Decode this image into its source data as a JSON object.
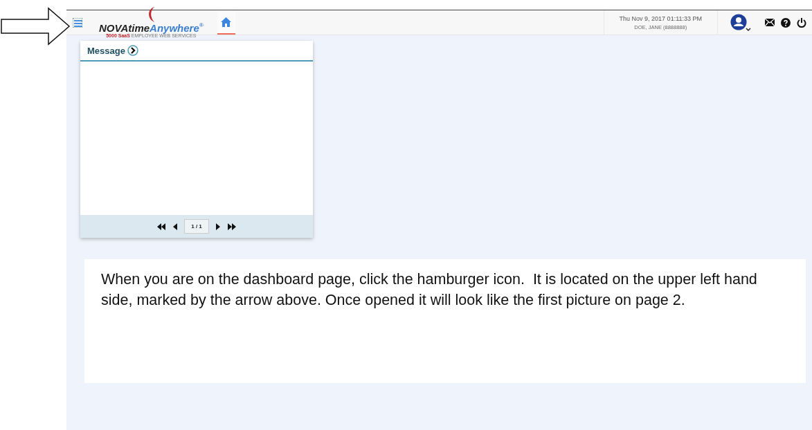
{
  "header": {
    "logo": {
      "brand_dark": "NOVAtime",
      "brand_light": "Anywhere",
      "mark": "®",
      "sub_red": "5000 SaaS",
      "sub_grey": "EMPLOYEE WEB SERVICES"
    },
    "home_tab": {
      "selected": true
    },
    "datetime": "Thu Nov 9, 2017 01:11:33 PM",
    "user": "DOE, JANE (8888888)"
  },
  "message_card": {
    "title": "Message",
    "pager": "1 / 1"
  },
  "instructions": "When you are on the dashboard page, click the hamburger icon.  It is located on the upper left hand side, marked by the arrow above. Once opened it will look like the first picture on page 2."
}
